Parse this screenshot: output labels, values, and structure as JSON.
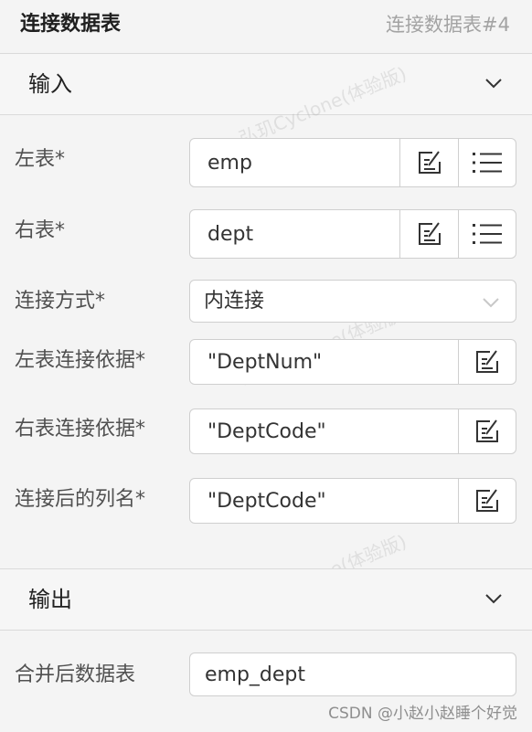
{
  "header": {
    "title": "连接数据表",
    "node_id": "连接数据表#4"
  },
  "input_section": {
    "title": "输入",
    "left_table": {
      "label": "左表*",
      "value": "emp"
    },
    "right_table": {
      "label": "右表*",
      "value": "dept"
    },
    "join_type": {
      "label": "连接方式*",
      "value": "内连接"
    },
    "left_key": {
      "label": "左表连接依据*",
      "value": "\"DeptNum\""
    },
    "right_key": {
      "label": "右表连接依据*",
      "value": "\"DeptCode\""
    },
    "joined_col": {
      "label": "连接后的列名*",
      "value": "\"DeptCode\""
    }
  },
  "output_section": {
    "title": "输出",
    "merged_table": {
      "label": "合并后数据表",
      "value": "emp_dept"
    }
  },
  "watermark": "弘玑Cyclone(体验版)",
  "credit": "CSDN @小赵小赵睡个好觉"
}
